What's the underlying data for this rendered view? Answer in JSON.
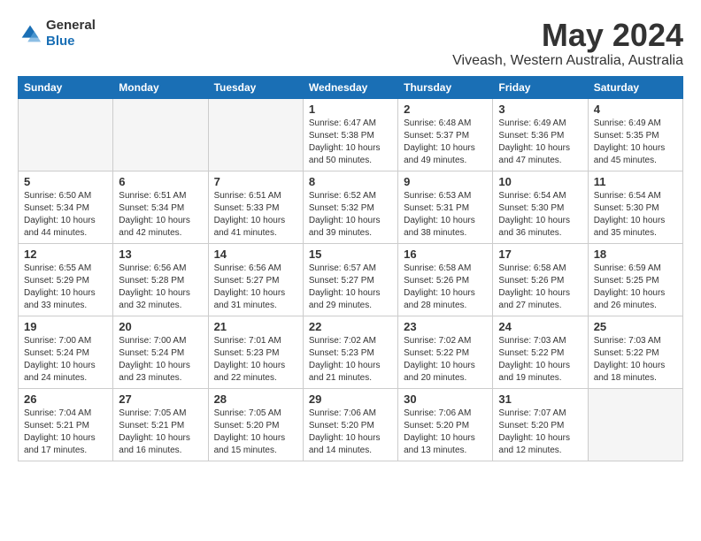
{
  "header": {
    "logo_general": "General",
    "logo_blue": "Blue",
    "month_title": "May 2024",
    "location": "Viveash, Western Australia, Australia"
  },
  "days_of_week": [
    "Sunday",
    "Monday",
    "Tuesday",
    "Wednesday",
    "Thursday",
    "Friday",
    "Saturday"
  ],
  "weeks": [
    [
      {
        "day": "",
        "sunrise": "",
        "sunset": "",
        "daylight": "",
        "empty": true
      },
      {
        "day": "",
        "sunrise": "",
        "sunset": "",
        "daylight": "",
        "empty": true
      },
      {
        "day": "",
        "sunrise": "",
        "sunset": "",
        "daylight": "",
        "empty": true
      },
      {
        "day": "1",
        "sunrise": "Sunrise: 6:47 AM",
        "sunset": "Sunset: 5:38 PM",
        "daylight": "Daylight: 10 hours and 50 minutes."
      },
      {
        "day": "2",
        "sunrise": "Sunrise: 6:48 AM",
        "sunset": "Sunset: 5:37 PM",
        "daylight": "Daylight: 10 hours and 49 minutes."
      },
      {
        "day": "3",
        "sunrise": "Sunrise: 6:49 AM",
        "sunset": "Sunset: 5:36 PM",
        "daylight": "Daylight: 10 hours and 47 minutes."
      },
      {
        "day": "4",
        "sunrise": "Sunrise: 6:49 AM",
        "sunset": "Sunset: 5:35 PM",
        "daylight": "Daylight: 10 hours and 45 minutes."
      }
    ],
    [
      {
        "day": "5",
        "sunrise": "Sunrise: 6:50 AM",
        "sunset": "Sunset: 5:34 PM",
        "daylight": "Daylight: 10 hours and 44 minutes."
      },
      {
        "day": "6",
        "sunrise": "Sunrise: 6:51 AM",
        "sunset": "Sunset: 5:34 PM",
        "daylight": "Daylight: 10 hours and 42 minutes."
      },
      {
        "day": "7",
        "sunrise": "Sunrise: 6:51 AM",
        "sunset": "Sunset: 5:33 PM",
        "daylight": "Daylight: 10 hours and 41 minutes."
      },
      {
        "day": "8",
        "sunrise": "Sunrise: 6:52 AM",
        "sunset": "Sunset: 5:32 PM",
        "daylight": "Daylight: 10 hours and 39 minutes."
      },
      {
        "day": "9",
        "sunrise": "Sunrise: 6:53 AM",
        "sunset": "Sunset: 5:31 PM",
        "daylight": "Daylight: 10 hours and 38 minutes."
      },
      {
        "day": "10",
        "sunrise": "Sunrise: 6:54 AM",
        "sunset": "Sunset: 5:30 PM",
        "daylight": "Daylight: 10 hours and 36 minutes."
      },
      {
        "day": "11",
        "sunrise": "Sunrise: 6:54 AM",
        "sunset": "Sunset: 5:30 PM",
        "daylight": "Daylight: 10 hours and 35 minutes."
      }
    ],
    [
      {
        "day": "12",
        "sunrise": "Sunrise: 6:55 AM",
        "sunset": "Sunset: 5:29 PM",
        "daylight": "Daylight: 10 hours and 33 minutes."
      },
      {
        "day": "13",
        "sunrise": "Sunrise: 6:56 AM",
        "sunset": "Sunset: 5:28 PM",
        "daylight": "Daylight: 10 hours and 32 minutes."
      },
      {
        "day": "14",
        "sunrise": "Sunrise: 6:56 AM",
        "sunset": "Sunset: 5:27 PM",
        "daylight": "Daylight: 10 hours and 31 minutes."
      },
      {
        "day": "15",
        "sunrise": "Sunrise: 6:57 AM",
        "sunset": "Sunset: 5:27 PM",
        "daylight": "Daylight: 10 hours and 29 minutes."
      },
      {
        "day": "16",
        "sunrise": "Sunrise: 6:58 AM",
        "sunset": "Sunset: 5:26 PM",
        "daylight": "Daylight: 10 hours and 28 minutes."
      },
      {
        "day": "17",
        "sunrise": "Sunrise: 6:58 AM",
        "sunset": "Sunset: 5:26 PM",
        "daylight": "Daylight: 10 hours and 27 minutes."
      },
      {
        "day": "18",
        "sunrise": "Sunrise: 6:59 AM",
        "sunset": "Sunset: 5:25 PM",
        "daylight": "Daylight: 10 hours and 26 minutes."
      }
    ],
    [
      {
        "day": "19",
        "sunrise": "Sunrise: 7:00 AM",
        "sunset": "Sunset: 5:24 PM",
        "daylight": "Daylight: 10 hours and 24 minutes."
      },
      {
        "day": "20",
        "sunrise": "Sunrise: 7:00 AM",
        "sunset": "Sunset: 5:24 PM",
        "daylight": "Daylight: 10 hours and 23 minutes."
      },
      {
        "day": "21",
        "sunrise": "Sunrise: 7:01 AM",
        "sunset": "Sunset: 5:23 PM",
        "daylight": "Daylight: 10 hours and 22 minutes."
      },
      {
        "day": "22",
        "sunrise": "Sunrise: 7:02 AM",
        "sunset": "Sunset: 5:23 PM",
        "daylight": "Daylight: 10 hours and 21 minutes."
      },
      {
        "day": "23",
        "sunrise": "Sunrise: 7:02 AM",
        "sunset": "Sunset: 5:22 PM",
        "daylight": "Daylight: 10 hours and 20 minutes."
      },
      {
        "day": "24",
        "sunrise": "Sunrise: 7:03 AM",
        "sunset": "Sunset: 5:22 PM",
        "daylight": "Daylight: 10 hours and 19 minutes."
      },
      {
        "day": "25",
        "sunrise": "Sunrise: 7:03 AM",
        "sunset": "Sunset: 5:22 PM",
        "daylight": "Daylight: 10 hours and 18 minutes."
      }
    ],
    [
      {
        "day": "26",
        "sunrise": "Sunrise: 7:04 AM",
        "sunset": "Sunset: 5:21 PM",
        "daylight": "Daylight: 10 hours and 17 minutes."
      },
      {
        "day": "27",
        "sunrise": "Sunrise: 7:05 AM",
        "sunset": "Sunset: 5:21 PM",
        "daylight": "Daylight: 10 hours and 16 minutes."
      },
      {
        "day": "28",
        "sunrise": "Sunrise: 7:05 AM",
        "sunset": "Sunset: 5:20 PM",
        "daylight": "Daylight: 10 hours and 15 minutes."
      },
      {
        "day": "29",
        "sunrise": "Sunrise: 7:06 AM",
        "sunset": "Sunset: 5:20 PM",
        "daylight": "Daylight: 10 hours and 14 minutes."
      },
      {
        "day": "30",
        "sunrise": "Sunrise: 7:06 AM",
        "sunset": "Sunset: 5:20 PM",
        "daylight": "Daylight: 10 hours and 13 minutes."
      },
      {
        "day": "31",
        "sunrise": "Sunrise: 7:07 AM",
        "sunset": "Sunset: 5:20 PM",
        "daylight": "Daylight: 10 hours and 12 minutes."
      },
      {
        "day": "",
        "sunrise": "",
        "sunset": "",
        "daylight": "",
        "empty": true
      }
    ]
  ]
}
